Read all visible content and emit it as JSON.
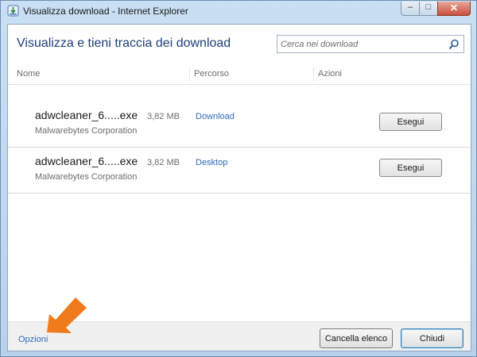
{
  "window": {
    "title": "Visualizza download - Internet Explorer",
    "app_icon": "download-manager-icon",
    "controls": {
      "minimize": "minimize-icon",
      "maximize": "maximize-icon",
      "close": "close-icon"
    }
  },
  "header": {
    "title": "Visualizza e tieni traccia dei download",
    "search": {
      "placeholder": "Cerca nei download",
      "value": "",
      "icon": "search-icon"
    }
  },
  "columns": [
    "Nome",
    "Percorso",
    "Azioni"
  ],
  "downloads": [
    {
      "name": "adwcleaner_6.....exe",
      "size": "3,82 MB",
      "publisher": "Malwarebytes Corporation",
      "location": "Download",
      "action": "Esegui"
    },
    {
      "name": "adwcleaner_6.....exe",
      "size": "3,82 MB",
      "publisher": "Malwarebytes Corporation",
      "location": "Desktop",
      "action": "Esegui"
    }
  ],
  "footer": {
    "options_label": "Opzioni",
    "clear_label": "Cancella elenco",
    "close_label": "Chiudi"
  },
  "colors": {
    "accent_link": "#2e6ab8",
    "heading": "#1e3f7a",
    "annotation_arrow": "#f07b1c"
  }
}
